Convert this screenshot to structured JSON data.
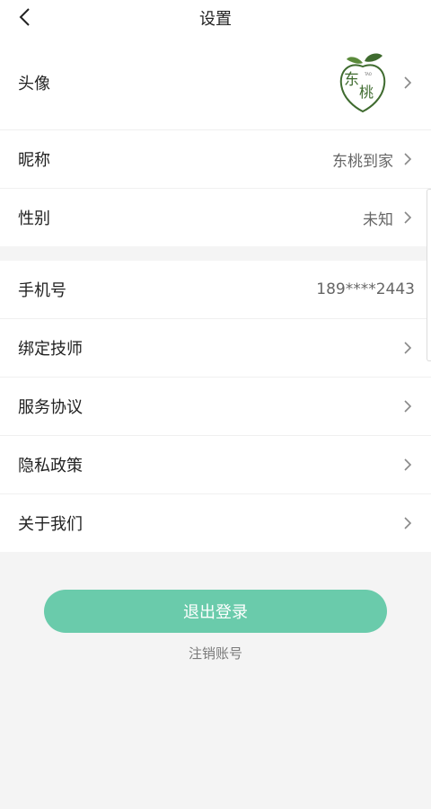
{
  "header": {
    "title": "设置"
  },
  "profile": {
    "avatar_label": "头像",
    "avatar_logo_text": "东桃",
    "nickname_label": "昵称",
    "nickname_value": "东桃到家",
    "gender_label": "性别",
    "gender_value": "未知"
  },
  "account": {
    "phone_label": "手机号",
    "phone_value": "189****2443",
    "bind_tech_label": "绑定技师",
    "service_label": "服务协议",
    "privacy_label": "隐私政策",
    "about_label": "关于我们"
  },
  "actions": {
    "logout_label": "退出登录",
    "deactivate_label": "注销账号"
  },
  "colors": {
    "accent": "#6acbab",
    "background": "#f4f4f4",
    "logo_green": "#3f6b2f"
  },
  "icons": [
    "back-arrow-icon",
    "chevron-right-icon"
  ]
}
